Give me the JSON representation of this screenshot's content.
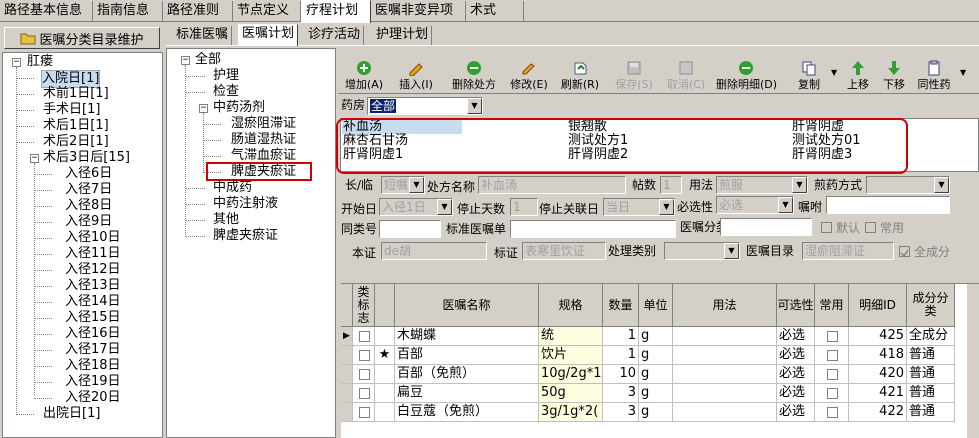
{
  "top_tabs": [
    "路径基本信息",
    "指南信息",
    "路径准则",
    "节点定义",
    "疗程计划",
    "医嘱非变异项",
    "术式"
  ],
  "active_top_tab": "疗程计划",
  "left_panel": {
    "button_label": "医嘱分类目录维护",
    "tree": {
      "root": "肛瘘",
      "children": [
        "入院日[1]",
        "术前1日[1]",
        "手术日[1]",
        "术后1日[1]",
        "术后2日[1]",
        "术后3日后[15]"
      ],
      "sub_children": [
        "入径6日",
        "入径7日",
        "入径8日",
        "入径9日",
        "入径10日",
        "入径11日",
        "入径12日",
        "入径13日",
        "入径14日",
        "入径15日",
        "入径16日",
        "入径17日",
        "入径18日",
        "入径19日",
        "入径20日"
      ],
      "last": "出院日[1]",
      "selected": "入院日[1]"
    }
  },
  "sub_tabs": [
    "标准医嘱",
    "医嘱计划",
    "诊疗活动",
    "护理计划"
  ],
  "active_sub_tab": "医嘱计划",
  "category_tree": {
    "root": "全部",
    "items": [
      "护理",
      "检查",
      "中药汤剂",
      "中成药",
      "中药注射液",
      "其他",
      "脾虚夹瘀证"
    ],
    "herbal_children": [
      "湿瘀阻滞证",
      "肠道湿热证",
      "气滞血瘀证",
      "脾虚夹瘀证"
    ],
    "selected": "脾虚夹瘀证"
  },
  "toolbar": [
    {
      "label": "增加(A)",
      "icon": "add-icon",
      "enabled": true
    },
    {
      "label": "插入(I)",
      "icon": "insert-icon",
      "enabled": true
    },
    {
      "label": "删除处方",
      "icon": "delete-prescription-icon",
      "enabled": true
    },
    {
      "label": "修改(E)",
      "icon": "edit-icon",
      "enabled": true
    },
    {
      "label": "刷新(R)",
      "icon": "refresh-icon",
      "enabled": true
    },
    {
      "label": "保存(S)",
      "icon": "save-icon",
      "enabled": false
    },
    {
      "label": "取消(C)",
      "icon": "cancel-icon",
      "enabled": false
    },
    {
      "label": "删除明细(D)",
      "icon": "delete-detail-icon",
      "enabled": true
    },
    {
      "label": "复制",
      "icon": "copy-icon",
      "enabled": true
    },
    {
      "label": "上移",
      "icon": "up-arrow-icon",
      "enabled": true
    },
    {
      "label": "下移",
      "icon": "down-arrow-icon",
      "enabled": true
    },
    {
      "label": "同性药",
      "icon": "same-drug-icon",
      "enabled": true
    }
  ],
  "pharmacy": {
    "label": "药房",
    "value": "全部"
  },
  "prescriptions": [
    [
      "补血汤",
      "银翘散",
      "肝肾阴虚"
    ],
    [
      "麻杏石甘汤",
      "测试处方1",
      "测试处方01"
    ],
    [
      "肝肾阴虚1",
      "肝肾阴虚2",
      "肝肾阴虚3"
    ]
  ],
  "form": {
    "long_temp_label": "长/临",
    "long_temp_value": "短嘱",
    "rx_name_label": "处方名称",
    "rx_name_value": "补血汤",
    "doses_label": "帖数",
    "doses_value": "1",
    "usage_label": "用法",
    "usage_value": "煎服",
    "decoct_label": "煎药方式",
    "decoct_value": "",
    "start_label": "开始日",
    "start_value": "入径1日",
    "stop_days_label": "停止天数",
    "stop_days_value": "1",
    "stop_link_label": "停止关联日",
    "stop_link_value": "当日",
    "required_label": "必选性",
    "required_value": "必选",
    "entrust_label": "嘱咐",
    "entrust_value": "",
    "class_no_label": "同类号",
    "class_no_value": "",
    "std_order_label": "标准医嘱单",
    "std_order_value": "",
    "order_cat_label": "医嘱分类",
    "order_cat_value": "",
    "default_label": "默认",
    "common_label": "常用",
    "syndrome_label": "本证",
    "syndrome_value": "de胡",
    "sign_label": "标证",
    "sign_value": "表寒里饮证",
    "process_label": "处理类别",
    "process_value": "",
    "order_dir_label": "医嘱目录",
    "order_dir_value": "湿瘀阻滞证",
    "full_label": "全成分"
  },
  "grid": {
    "headers": [
      "类标志",
      "医嘱名称",
      "规格",
      "数量",
      "单位",
      "用法",
      "可选性",
      "常用",
      "明细ID",
      "成分分类"
    ],
    "rows": [
      {
        "star": "",
        "name": "木蝴蝶",
        "spec": "统",
        "qty": "1",
        "unit": "g",
        "usage": "",
        "opt": "必选",
        "id": "425",
        "cat": "全成分",
        "current": true
      },
      {
        "star": "★",
        "name": "百部",
        "spec": "饮片",
        "qty": "1",
        "unit": "g",
        "usage": "",
        "opt": "必选",
        "id": "418",
        "cat": "普通",
        "current": false
      },
      {
        "star": "",
        "name": "百部（免煎）",
        "spec": "10g/2g*1",
        "qty": "10",
        "unit": "g",
        "usage": "",
        "opt": "必选",
        "id": "420",
        "cat": "普通",
        "current": false
      },
      {
        "star": "",
        "name": "扁豆",
        "spec": "50g",
        "qty": "3",
        "unit": "g",
        "usage": "",
        "opt": "必选",
        "id": "421",
        "cat": "普通",
        "current": false
      },
      {
        "star": "",
        "name": "白豆蔻（免煎）",
        "spec": "3g/1g*2(",
        "qty": "3",
        "unit": "g",
        "usage": "",
        "opt": "必选",
        "id": "422",
        "cat": "普通",
        "current": false
      }
    ]
  },
  "colors": {
    "highlight_red": "#d00000",
    "selection": "#c8dcf0",
    "window_bg": "#d4d0c8"
  }
}
